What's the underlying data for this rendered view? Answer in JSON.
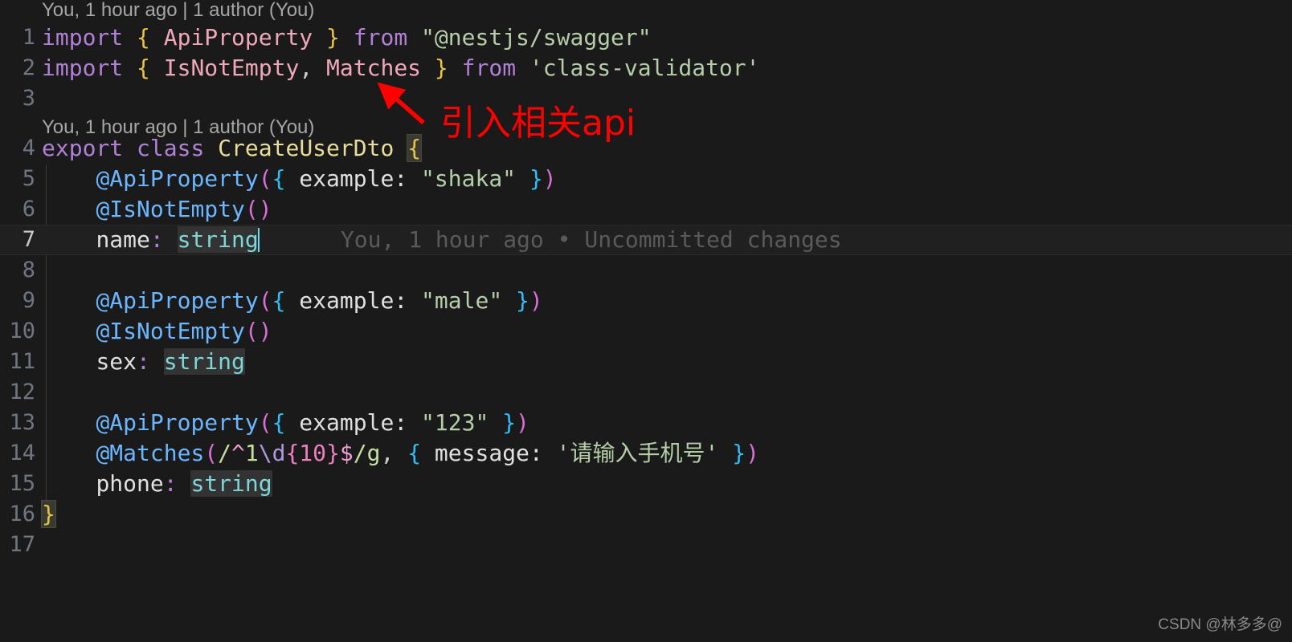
{
  "editor": {
    "background": "#1a1a1a",
    "language": "typescript",
    "filename_implied": "create-user.dto.ts",
    "active_line": 7,
    "indent_guide_color": "#3b3b3b"
  },
  "codelens": {
    "top_label": "You, 1 hour ago | 1 author (You)",
    "class_label": "You, 1 hour ago | 1 author (You)"
  },
  "inline_blame": {
    "text": "You, 1 hour ago • Uncommitted changes"
  },
  "gutter": {
    "numbers": [
      "1",
      "2",
      "3",
      "4",
      "5",
      "6",
      "7",
      "8",
      "9",
      "10",
      "11",
      "12",
      "13",
      "14",
      "15",
      "16",
      "17"
    ],
    "cropped_note": "left digits clipped by screenshot edge"
  },
  "lines": {
    "l1": {
      "num": "1",
      "kw_import": "import",
      "brace_open": "{",
      "ident": "ApiProperty",
      "brace_close": "}",
      "kw_from": "from",
      "module": "\"@nestjs/swagger\""
    },
    "l2": {
      "num": "2",
      "kw_import": "import",
      "brace_open": "{",
      "ident1": "IsNotEmpty",
      "comma": ",",
      "ident2": "Matches",
      "brace_close": "}",
      "kw_from": "from",
      "module": "'class-validator'"
    },
    "l4": {
      "num": "4",
      "kw_export": "export",
      "kw_class": "class",
      "class_name": "CreateUserDto",
      "brace_open": "{"
    },
    "l5": {
      "num": "5",
      "decorator": "@ApiProperty",
      "paren_open": "(",
      "curly_open": "{",
      "key": " example: ",
      "value": "\"shaka\"",
      "curly_close": "}",
      "paren_close": ")"
    },
    "l6": {
      "num": "6",
      "decorator": "@IsNotEmpty",
      "parens": "()"
    },
    "l7": {
      "num": "7",
      "prop": "name",
      "colon": ":",
      "type": "string"
    },
    "l9": {
      "num": "9",
      "decorator": "@ApiProperty",
      "paren_open": "(",
      "curly_open": "{",
      "key": " example: ",
      "value": "\"male\"",
      "curly_close": "}",
      "paren_close": ")"
    },
    "l10": {
      "num": "10",
      "decorator": "@IsNotEmpty",
      "parens": "()"
    },
    "l11": {
      "num": "11",
      "prop": "sex",
      "colon": ":",
      "type": "string"
    },
    "l13": {
      "num": "13",
      "decorator": "@ApiProperty",
      "paren_open": "(",
      "curly_open": "{",
      "key": " example: ",
      "value": "\"123\"",
      "curly_close": "}",
      "paren_close": ")"
    },
    "l14": {
      "num": "14",
      "decorator": "@Matches",
      "paren_open": "(",
      "re_open": "/",
      "re_anchor_start": "^",
      "re_lit": "1",
      "re_esc": "\\d",
      "re_quant": "{10}",
      "re_anchor_end": "$",
      "re_close": "/",
      "re_flags": "g",
      "comma": ",",
      "curly_open": "{",
      "key": " message: ",
      "value": "'请输入手机号'",
      "curly_close": "}",
      "paren_close": ")"
    },
    "l15": {
      "num": "15",
      "prop": "phone",
      "colon": ":",
      "type": "string"
    },
    "l16": {
      "num": "16",
      "brace_close": "}"
    },
    "l17": {
      "num": "17"
    }
  },
  "annotation": {
    "text": "引入相关api",
    "color": "#ff0000",
    "arrow_color": "#ff0000"
  },
  "watermark": {
    "text": "CSDN @林多多@"
  },
  "colors": {
    "background": "#1a1a1a",
    "active_line": "#202020",
    "keyword": "#b180d7",
    "import_ident": "#f0a8b8",
    "brace_gold": "#e8c547",
    "string": "#b5cea8",
    "decorator": "#6cb6ff",
    "paren": "#d96fd6",
    "curly": "#31bdf5",
    "class_name": "#e8dd9a",
    "type": "#7fd6d6",
    "caret": "#6fd8e8",
    "gutter_number": "#6e7681",
    "codelens_text": "#a6a6a6",
    "inline_blame_text": "#5a5a5a",
    "word_highlight": "#333333"
  }
}
